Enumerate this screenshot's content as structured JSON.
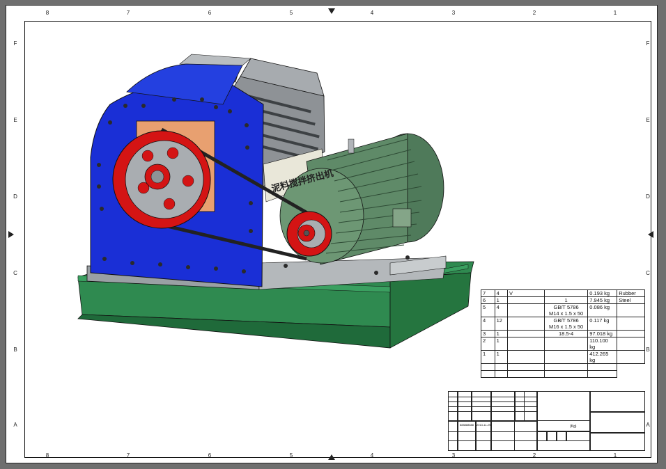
{
  "drawing": {
    "zones_columns": [
      "8",
      "7",
      "6",
      "5",
      "4",
      "3",
      "2",
      "1"
    ],
    "zones_rows": [
      "F",
      "E",
      "D",
      "C",
      "B",
      "A"
    ],
    "rotated_label": "泥料搅拌挤出机"
  },
  "bom": {
    "rows": [
      {
        "item": "7",
        "qty": "4",
        "part": "V",
        "std": "",
        "mass": "0.193 kg",
        "material": "Rubber"
      },
      {
        "item": "6",
        "qty": "1",
        "part": "",
        "std": "1",
        "mass": "7.945 kg",
        "material": "Steel"
      },
      {
        "item": "5",
        "qty": "4",
        "part": "",
        "std": "GB/T 5786\nM14 x 1.5 x 50",
        "mass": "0.086 kg",
        "material": ""
      },
      {
        "item": "4",
        "qty": "12",
        "part": "",
        "std": "GB/T 5786\nM16 x 1.5 x 50",
        "mass": "0.117 kg",
        "material": ""
      },
      {
        "item": "3",
        "qty": "1",
        "part": "",
        "std": "18.5-4",
        "mass": "97.018 kg",
        "material": ""
      },
      {
        "item": "2",
        "qty": "1",
        "part": "",
        "std": "",
        "mass": "110.100\nkg",
        "material": ""
      },
      {
        "item": "1",
        "qty": "1",
        "part": "",
        "std": "",
        "mass": "412.265\nkg",
        "material": ""
      }
    ]
  },
  "title_block": {
    "designer": "888888888",
    "date": "2013-11-29",
    "weight_unit": "(Kg)"
  },
  "colors": {
    "blue_frame": "#1a2fd6",
    "green_base": "#2f8a50",
    "motor_green": "#5f8a68",
    "pulley_red": "#d41414",
    "copper": "#e8a070"
  }
}
